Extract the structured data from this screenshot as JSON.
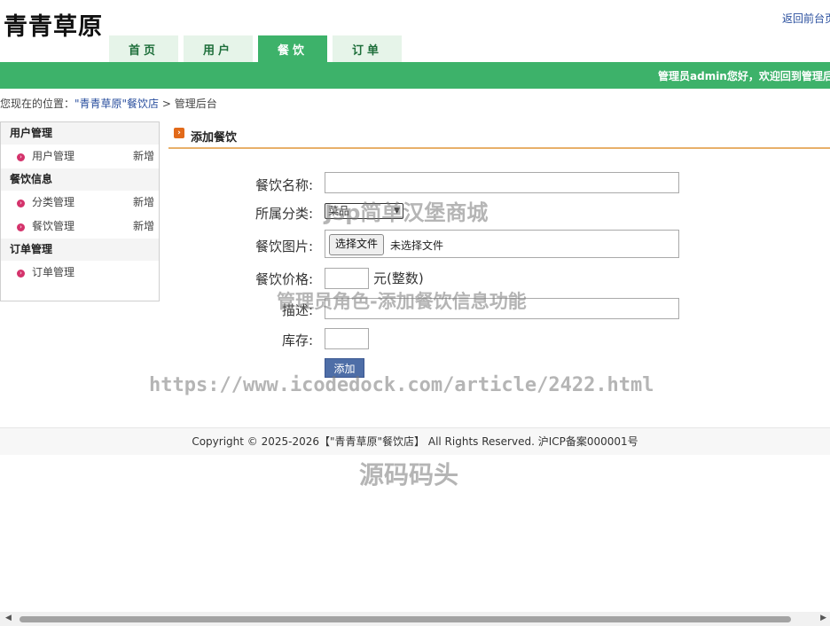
{
  "header": {
    "logo": "青青草原",
    "back_link": "返回前台页",
    "nav": [
      {
        "label": "首页"
      },
      {
        "label": "用户"
      },
      {
        "label": "餐饮"
      },
      {
        "label": "订单"
      }
    ],
    "welcome": "管理员admin您好，欢迎回到管理后台"
  },
  "breadcrumb": {
    "prefix": "您现在的位置：",
    "shop": "\"青青草原\"餐饮店",
    "sep": ">",
    "current": "管理后台"
  },
  "sidebar": {
    "sections": [
      {
        "title": "用户管理",
        "items": [
          {
            "label": "用户管理",
            "add": "新增"
          }
        ]
      },
      {
        "title": "餐饮信息",
        "items": [
          {
            "label": "分类管理",
            "add": "新增"
          },
          {
            "label": "餐饮管理",
            "add": "新增"
          }
        ]
      },
      {
        "title": "订单管理",
        "items": [
          {
            "label": "订单管理"
          }
        ]
      }
    ]
  },
  "content": {
    "title": "添加餐饮",
    "form": {
      "name_label": "餐饮名称:",
      "name_value": "",
      "category_label": "所属分类:",
      "category_value": "菜品",
      "image_label": "餐饮图片:",
      "file_button": "选择文件",
      "file_status": "未选择文件",
      "price_label": "餐饮价格:",
      "price_value": "",
      "price_unit": "元(整数)",
      "desc_label": "描述:",
      "desc_value": "",
      "stock_label": "库存:",
      "stock_value": "",
      "submit": "添加"
    }
  },
  "footer": {
    "copyright": "Copyright © 2025-2026【\"青青草原\"餐饮店】 All Rights Reserved. 沪ICP备案000001号"
  },
  "watermarks": {
    "w1": "Jsp简单汉堡商城",
    "w2": "管理员角色-添加餐饮信息功能",
    "w3": "https://www.icodedock.com/article/2422.html",
    "w4": "源码码头"
  },
  "colors": {
    "brand_green": "#3db26a",
    "tab_bg": "#e6f4e9",
    "accent_orange": "#e8b06a",
    "button_blue": "#4e6ea7"
  }
}
